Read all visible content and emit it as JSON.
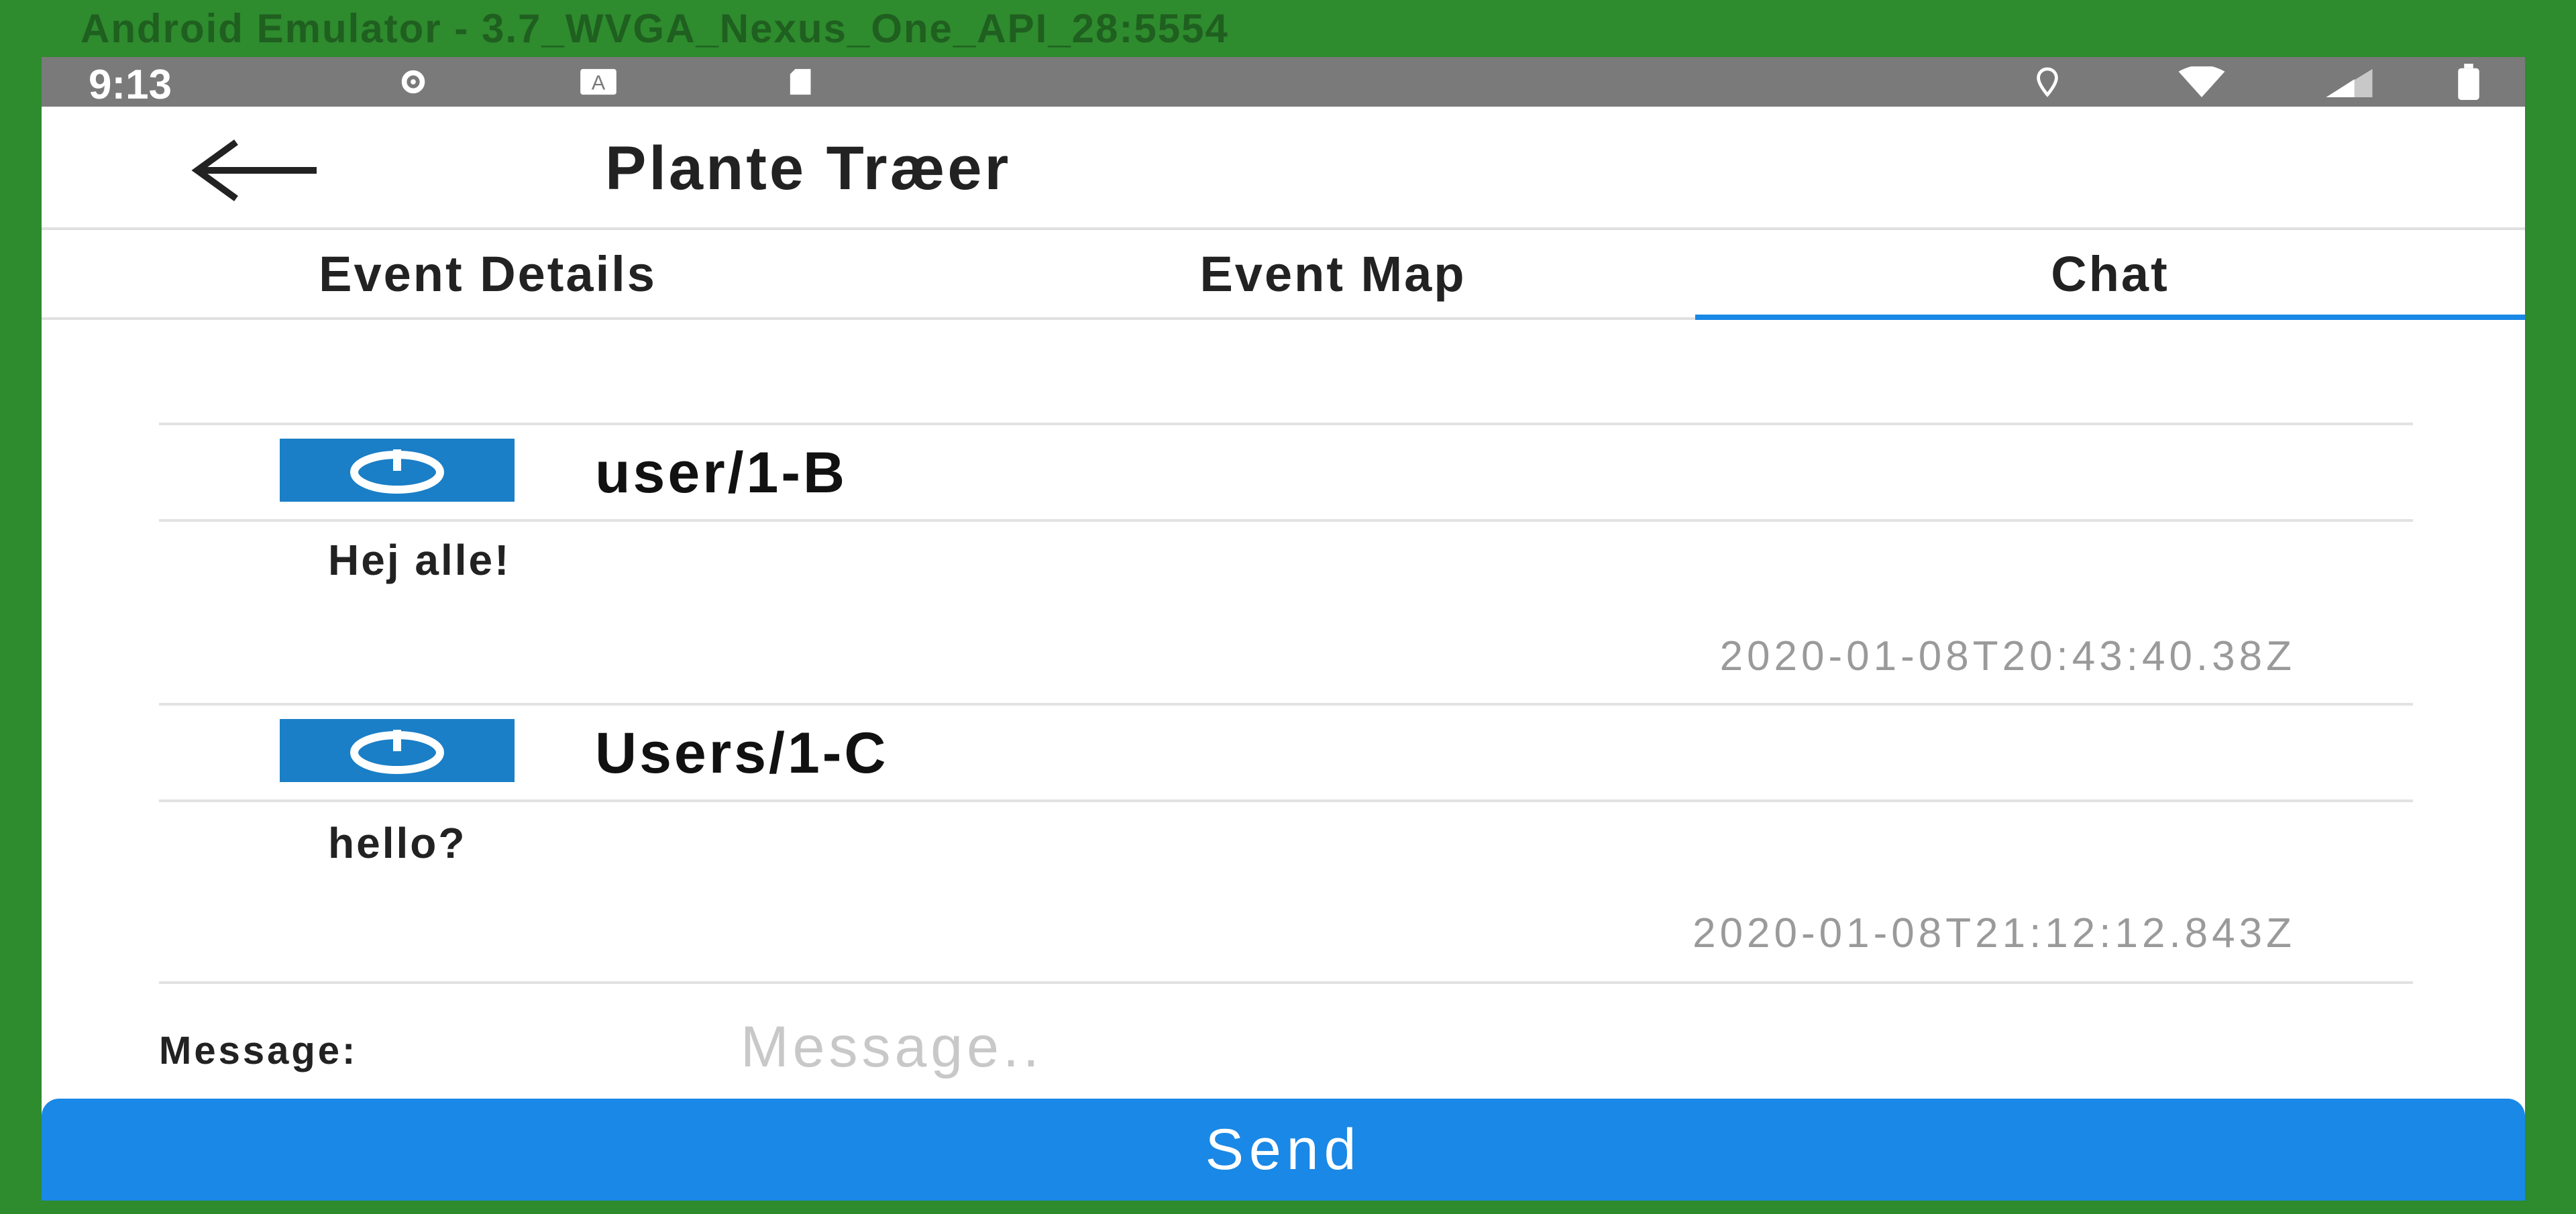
{
  "emulator": {
    "title": "Android Emulator - 3.7_WVGA_Nexus_One_API_28:5554"
  },
  "status_bar": {
    "time": "9:13",
    "left_icons": [
      "gear-icon",
      "keyboard-icon",
      "sd-card-icon"
    ],
    "right_icons": [
      "location-icon",
      "wifi-icon",
      "signal-icon",
      "battery-icon"
    ]
  },
  "app_bar": {
    "title": "Plante Træer",
    "back_icon": "arrow-back-icon"
  },
  "tabs": [
    {
      "label": "Event Details",
      "active": false
    },
    {
      "label": "Event Map",
      "active": false
    },
    {
      "label": "Chat",
      "active": true
    }
  ],
  "messages": [
    {
      "user": "user/1-B",
      "text": "Hej alle!",
      "timestamp": "2020-01-08T20:43:40.38Z"
    },
    {
      "user": "Users/1-C",
      "text": "hello?",
      "timestamp": "2020-01-08T21:12:12.843Z"
    }
  ],
  "composer": {
    "label": "Message:",
    "placeholder": "Message..",
    "value": "",
    "send_label": "Send"
  },
  "colors": {
    "accent": "#1a88e6",
    "avatar": "#1a7fc6",
    "emulator_frame": "#2e8b2e",
    "status_bar": "#7a7a7a"
  }
}
